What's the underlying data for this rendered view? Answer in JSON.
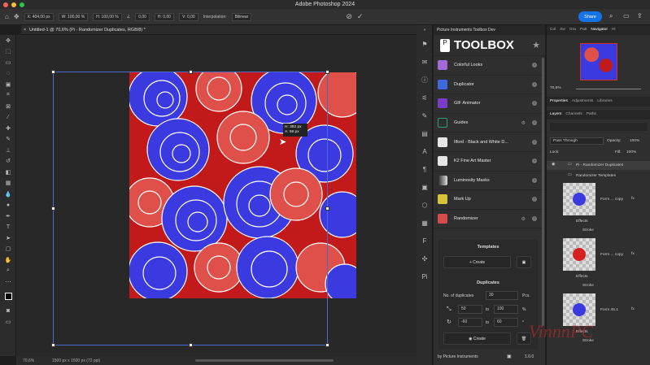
{
  "app": {
    "title": "Adobe Photoshop 2024"
  },
  "options": {
    "x": "X: 404,00 px",
    "w": "W: 100,00 %",
    "h": "H: 100,00 %",
    "angle": "0,00",
    "hs": "H: 0,00",
    "v": "V: 0,00",
    "interp_label": "Interpolation:",
    "interp": "Bilinear",
    "share": "Share"
  },
  "document": {
    "tab": "Untitled-1 @ 70,6% (Pi - Randomizer Duplicates, RGB/8) *",
    "tooltip1": "H: 392 px",
    "tooltip2": "A: 59 px",
    "zoom": "70,6%",
    "size": "1500 px x 1500 px (72 ppi)"
  },
  "plugin": {
    "tab": "Picture Instruments Toolbox Dev",
    "header": "TOOLBOX",
    "items": [
      {
        "label": "Colorful Looks",
        "color": "#a46bd6"
      },
      {
        "label": "Duplicator",
        "color": "#3b6ad6"
      },
      {
        "label": "GIF Animator",
        "color": "#7a3cc9"
      },
      {
        "label": "Guides",
        "color": "#2f9b7a"
      },
      {
        "label": "Ilford - Black and White D...",
        "color": "#e6e6e6"
      },
      {
        "label": "K2 Fine Art Master",
        "color": "#e6e6e6"
      },
      {
        "label": "Luminosity Masks",
        "color": "#9a9a9a"
      },
      {
        "label": "Mark Up",
        "color": "#d6c23b"
      },
      {
        "label": "Randomizer",
        "color": "#d64b4b"
      }
    ],
    "templates": {
      "title": "Templates",
      "create": "Create"
    },
    "duplicates": {
      "title": "Duplicates",
      "num_label": "No. of duplicates",
      "num": "30",
      "pcs": "Pcs.",
      "r1_from": "50",
      "r1_to_label": "to",
      "r1_to": "100",
      "r1_unit": "%",
      "r2_from": "-60",
      "r2_to_label": "to",
      "r2_to": "60",
      "r2_unit": "°",
      "create": "Create"
    },
    "footer": "by Picture Instruments",
    "version": "1.0.0"
  },
  "right": {
    "tabs": [
      "Col",
      "Sw",
      "Gra",
      "Patt",
      "Navigator",
      "Hi"
    ],
    "zoom": "70,6%",
    "tabs2": [
      "Properties",
      "Adjustments",
      "Libraries"
    ],
    "tabs3": [
      "Layers",
      "Channels",
      "Paths"
    ],
    "blend": "Pass Through",
    "opacity_label": "Opacity:",
    "opacity": "100%",
    "lock_label": "Lock:",
    "fill_label": "Fill:",
    "fill": "100%",
    "groups": [
      "Pi - Randomizer Duplicates",
      "Randomizer Templates"
    ],
    "layers": [
      {
        "name": "Form ... copy",
        "effects": "Effects",
        "stroke": "Stroke"
      },
      {
        "name": "Form ... copy",
        "effects": "Effects",
        "stroke": "Stroke"
      },
      {
        "name": "Form 45.1",
        "effects": "Effects",
        "stroke": "Stroke"
      }
    ]
  },
  "watermark": "VinnnPC"
}
